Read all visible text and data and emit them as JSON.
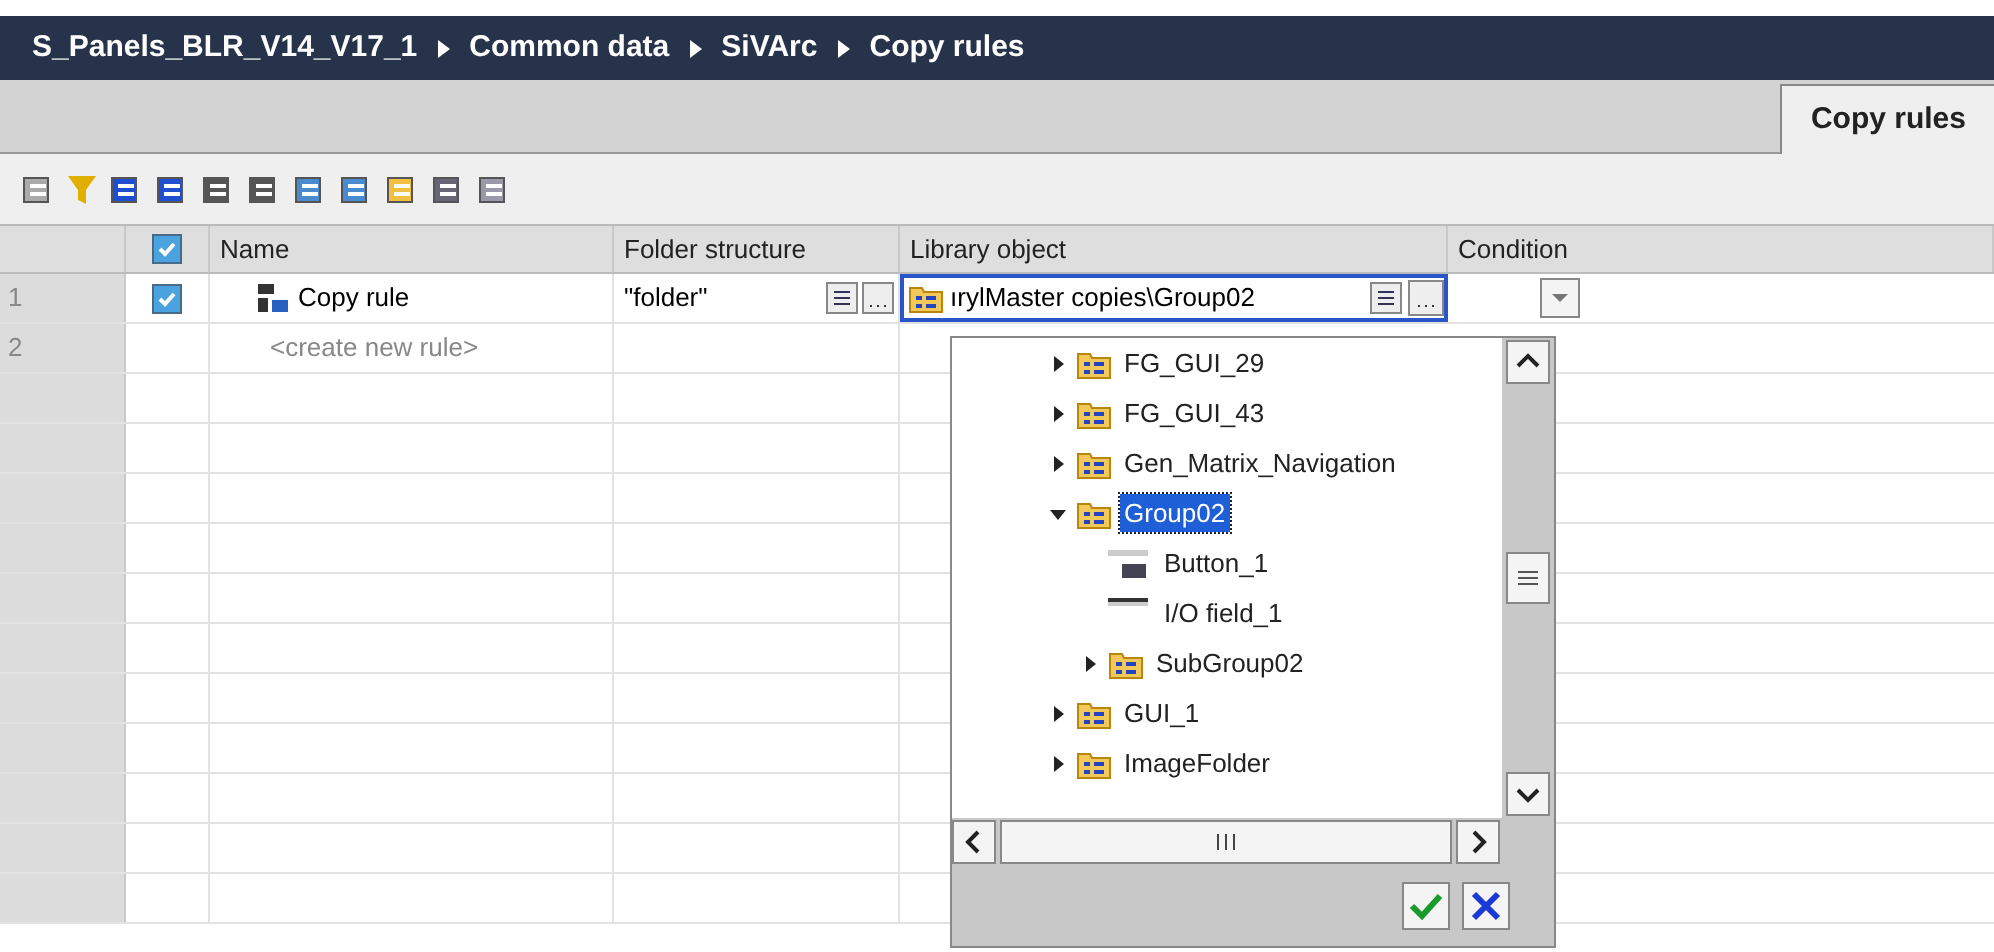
{
  "breadcrumb": [
    "S_Panels_BLR_V14_V17_1",
    "Common data",
    "SiVArc",
    "Copy rules"
  ],
  "tabs": [
    {
      "label": "Copy rules",
      "selected": true
    }
  ],
  "table": {
    "header_checked": true,
    "columns": [
      "Name",
      "Folder structure",
      "Library object",
      "Condition"
    ],
    "rows": [
      {
        "number": "1",
        "checked": true,
        "name": "Copy rule",
        "folder": "\"folder\"",
        "library_object": "ırylMaster copies\\Group02",
        "kind": "rule"
      },
      {
        "number": "2",
        "name": "<create new rule>",
        "kind": "new"
      }
    ]
  },
  "tree": [
    {
      "label": "FG_GUI_29",
      "kind": "folder",
      "expanded": false,
      "selected": false
    },
    {
      "label": "FG_GUI_43",
      "kind": "folder",
      "expanded": false,
      "selected": false
    },
    {
      "label": "Gen_Matrix_Navigation",
      "kind": "folder",
      "expanded": false,
      "selected": false
    },
    {
      "label": "Group02",
      "kind": "folder",
      "expanded": true,
      "selected": true,
      "children": [
        {
          "label": "Button_1",
          "kind": "button",
          "selected": false
        },
        {
          "label": "I/O field_1",
          "kind": "iofield",
          "selected": false
        },
        {
          "label": "SubGroup02",
          "kind": "folder",
          "expanded": false,
          "selected": false
        }
      ]
    },
    {
      "label": "GUI_1",
      "kind": "folder",
      "expanded": false,
      "selected": false
    },
    {
      "label": "ImageFolder",
      "kind": "folder",
      "expanded": false,
      "selected": false
    }
  ]
}
